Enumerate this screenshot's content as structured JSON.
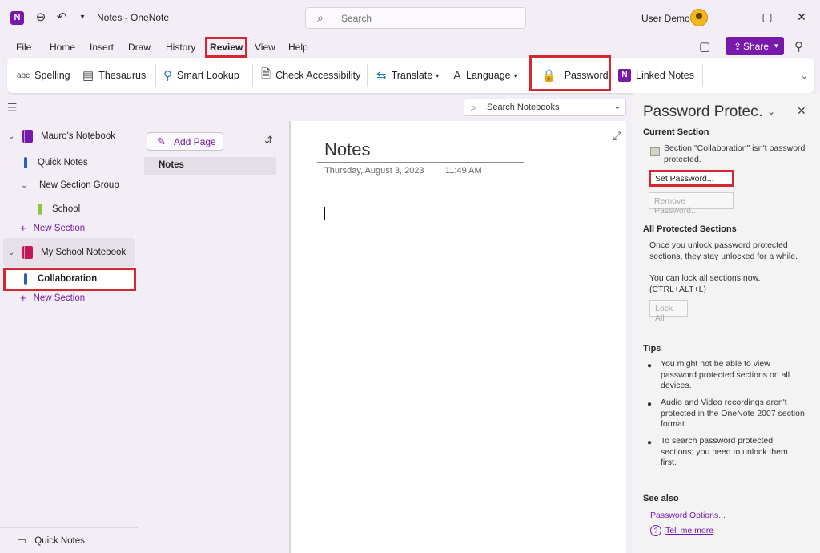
{
  "titlebar": {
    "app_icon_letter": "N",
    "title": "Notes  -  OneNote",
    "search_placeholder": "Search",
    "user": "User Demo"
  },
  "menu": {
    "tabs": [
      "File",
      "Home",
      "Insert",
      "Draw",
      "History",
      "Review",
      "View",
      "Help"
    ],
    "active": "Review",
    "share_label": "Share"
  },
  "ribbon": {
    "spelling": "Spelling",
    "spelling_icon_text": "abc",
    "thesaurus": "Thesaurus",
    "smart_lookup": "Smart Lookup",
    "check_accessibility": "Check Accessibility",
    "translate": "Translate",
    "language": "Language",
    "password": "Password",
    "linked_notes": "Linked Notes",
    "linked_notes_icon_letter": "N"
  },
  "nav": {
    "notebooks": [
      {
        "name": "Mauro's Notebook",
        "color": "#7719aa",
        "sections": [
          {
            "name": "Quick Notes",
            "color": "#2760b8"
          },
          {
            "name": "New Section Group",
            "group": true
          },
          {
            "name": "School",
            "color": "#8cc63f"
          }
        ],
        "new_section": "New Section"
      },
      {
        "name": "My  School Notebook",
        "color": "#c2185b",
        "sections": [
          {
            "name": "Collaboration",
            "color": "#2760b8"
          }
        ],
        "new_section": "New Section"
      }
    ],
    "bottom": "Quick Notes"
  },
  "pagelist": {
    "add_page": "Add Page",
    "pages": [
      "Notes"
    ]
  },
  "note": {
    "title": "Notes",
    "date": "Thursday, August 3, 2023",
    "time": "11:49 AM"
  },
  "search_notebooks": "Search Notebooks",
  "pane": {
    "title": "Password Protec…",
    "current_section_heading": "Current Section",
    "status_text": "Section \"Collaboration\" isn't password protected.",
    "set_password": "Set Password...",
    "remove_password": "Remove Password...",
    "all_protected_heading": "All Protected Sections",
    "unlock_text": "Once you unlock password protected sections, they stay unlocked for a while.",
    "lock_now_text": "You can lock all sections now. (CTRL+ALT+L)",
    "lock_all": "Lock All",
    "tips_heading": "Tips",
    "tips": [
      "You might not be able to view password protected sections on all devices.",
      "Audio and Video recordings aren't protected in the OneNote 2007 section format.",
      "To search password protected sections, you need to unlock them first."
    ],
    "see_also_heading": "See also",
    "password_options": "Password Options...",
    "tell_me_more": "Tell me more"
  }
}
